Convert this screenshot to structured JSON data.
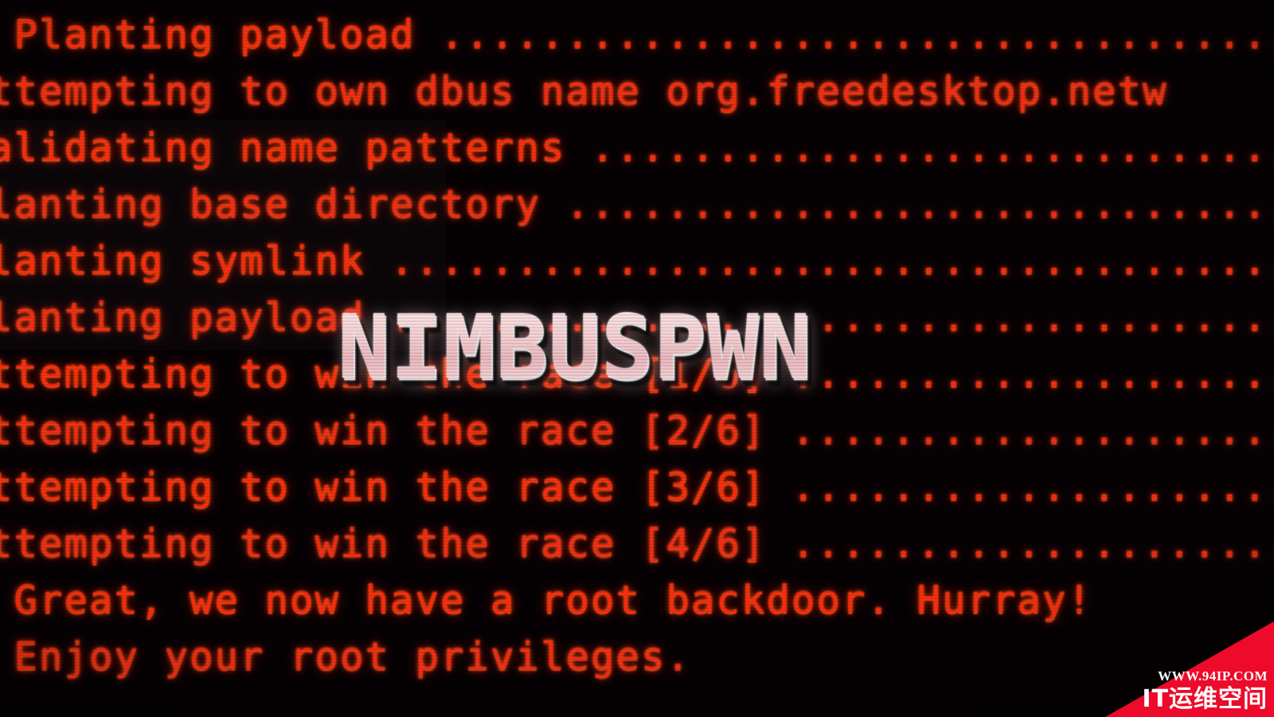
{
  "screen": {
    "kind": "terminal-photograph",
    "background_color": "#050103",
    "text_color": "#e8341d",
    "glow_color": "#ff6a34"
  },
  "terminal": {
    "lines": [
      " Planting payload ..............................................",
      "ttempting to own dbus name org.freedesktop.netw",
      "alidating name patterns ........................................",
      "lanting base directory .........................................",
      "lanting symlink ................................................",
      "lanting payload ................................................",
      "ttempting to win the race [1/6] ................................",
      "ttempting to win the race [2/6] ................................",
      "ttempting to win the race [3/6] ................................",
      "ttempting to win the race [4/6] ................................",
      " Great, we now have a root backdoor. Hurray!",
      " Enjoy your root privileges."
    ]
  },
  "logo": {
    "text": "NIMBUSPWN",
    "fill_color": "#f6d3d6",
    "outline_color": "#ffffff"
  },
  "watermark": {
    "url": "WWW.94IP.COM",
    "brand": "IT运维空间",
    "triangle_color": "#ee0a2a",
    "text_color": "#ffffff"
  }
}
